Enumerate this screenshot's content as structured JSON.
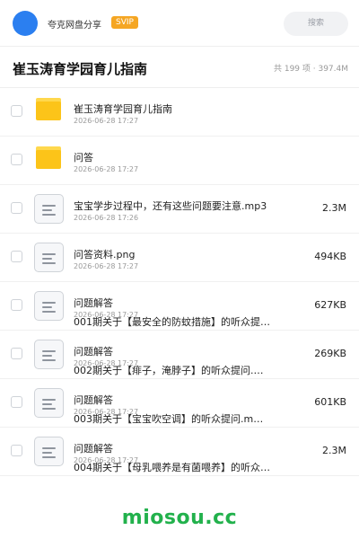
{
  "header": {
    "username": "夸克网盘分享",
    "badge": "SVIP",
    "search_placeholder": "搜索",
    "colors": {
      "avatar": "#2b7ff0",
      "badge": "#f5a623"
    }
  },
  "folder": {
    "title": "崔玉涛育学园育儿指南",
    "stats": "共 199 项 · 397.4M"
  },
  "items": [
    {
      "type": "folder",
      "name": "崔玉涛育学园育儿指南",
      "date": "2026-06-28 17:27",
      "size": ""
    },
    {
      "type": "folder",
      "name": "问答",
      "date": "2026-06-28 17:27",
      "size": ""
    },
    {
      "type": "file",
      "name": "宝宝学步过程中，还有这些问题要注意.mp3",
      "date": "2026-06-28 17:26",
      "size": "2.3M"
    },
    {
      "type": "file",
      "name": "问答资料.png",
      "date": "2026-06-28 17:27",
      "size": "494KB"
    },
    {
      "type": "file",
      "name": "问题解答",
      "date": "2026-06-28 17:27",
      "desc": "001期关于【最安全的防蚊措施】的听众提…",
      "size": "627KB"
    },
    {
      "type": "file",
      "name": "问题解答",
      "date": "2026-06-28 17:27",
      "desc": "002期关于【痱子，淹脖子】的听众提问.…",
      "size": "269KB"
    },
    {
      "type": "file",
      "name": "问题解答",
      "date": "2026-06-28 17:27",
      "desc": "003期关于【宝宝吹空调】的听众提问.m…",
      "size": "601KB"
    },
    {
      "type": "file",
      "name": "问题解答",
      "date": "2026-06-28 17:27",
      "desc": "004期关于【母乳喂养是有菌喂养】的听众…",
      "size": "2.3M"
    }
  ],
  "watermark": "miosou.cc"
}
